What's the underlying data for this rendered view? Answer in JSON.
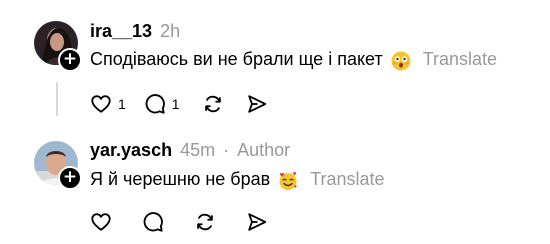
{
  "comments": [
    {
      "username": "ira__13",
      "time": "2h",
      "text": "Сподіваюсь ви не брали ще і пакет",
      "emoji": "astonished-face",
      "translate": "Translate",
      "likes": "1",
      "replies": "1",
      "badge": "+"
    },
    {
      "username": "yar.yasch",
      "time": "45m",
      "separator": "·",
      "author_label": "Author",
      "text": "Я й черешню не брав",
      "emoji": "smiling-face-with-hearts",
      "translate": "Translate",
      "badge": "+"
    }
  ],
  "icons": {
    "like": "heart-icon",
    "reply": "comment-icon",
    "repost": "repost-icon",
    "share": "send-icon"
  },
  "colors": {
    "text": "#000000",
    "muted": "#999999",
    "thread_line": "#d9d9d9",
    "emoji_yellow": "#f7c42b"
  }
}
